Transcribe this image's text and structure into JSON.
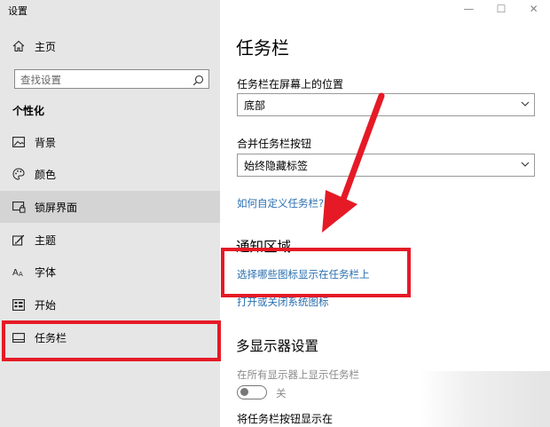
{
  "app_title": "设置",
  "window_controls": [
    "—",
    "☐",
    "✕"
  ],
  "sidebar": {
    "home": "主页",
    "search_placeholder": "查找设置",
    "section": "个性化",
    "items": [
      {
        "label": "背景",
        "icon": "image-icon"
      },
      {
        "label": "颜色",
        "icon": "palette-icon"
      },
      {
        "label": "锁屏界面",
        "icon": "lock-screen-icon"
      },
      {
        "label": "主题",
        "icon": "theme-brush-icon"
      },
      {
        "label": "字体",
        "icon": "font-icon"
      },
      {
        "label": "开始",
        "icon": "start-icon"
      },
      {
        "label": "任务栏",
        "icon": "taskbar-icon"
      }
    ]
  },
  "main": {
    "title": "任务栏",
    "position_label": "任务栏在屏幕上的位置",
    "position_value": "底部",
    "combine_label": "合并任务栏按钮",
    "combine_value": "始终隐藏标签",
    "customize_link": "如何自定义任务栏?",
    "notification_heading": "通知区域",
    "select_icons_link": "选择哪些图标显示在任务栏上",
    "system_icons_link": "打开或关闭系统图标",
    "multi_display_heading": "多显示器设置",
    "show_all_label": "在所有显示器上显示任务栏",
    "toggle_state": "关",
    "show_buttons_label": "将任务栏按钮显示在"
  },
  "annotation_color": "#e51a26"
}
